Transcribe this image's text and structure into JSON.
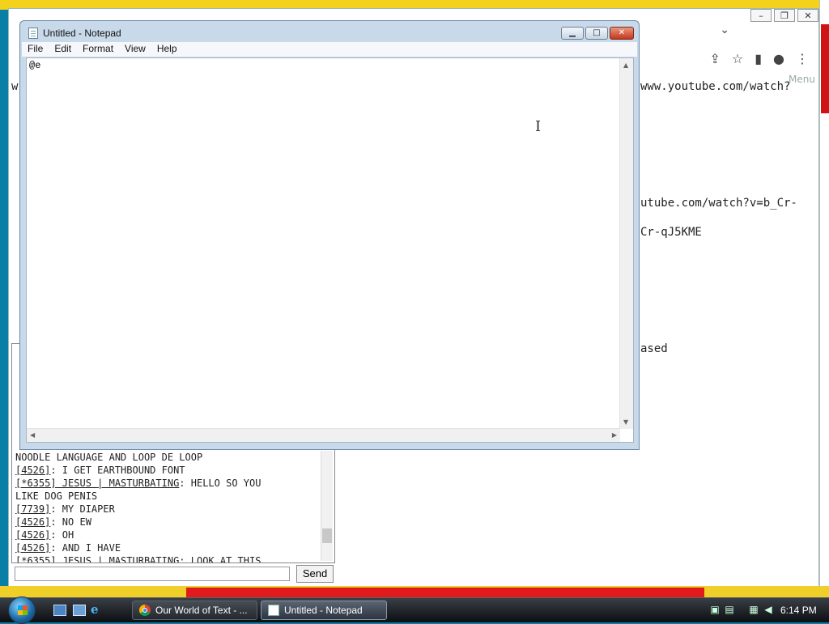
{
  "notepad": {
    "title": "Untitled - Notepad",
    "menu": [
      "File",
      "Edit",
      "Format",
      "View",
      "Help"
    ],
    "content": "@e"
  },
  "browser": {
    "menu_label": "Menu",
    "lines": [
      "www.youtube.com/watch?",
      "utube.com/watch?v=b_Cr-",
      "Cr-qJ5KME",
      "ased"
    ],
    "left_char": "w"
  },
  "chat": {
    "lines": [
      {
        "user": "",
        "text": "NOODLE LANGUAGE AND LOOP DE LOOP"
      },
      {
        "user": "[4526]",
        "text": ": I GET EARTHBOUND FONT"
      },
      {
        "user": "[*6355] JESUS | MASTURBATING",
        "text": ": HELLO SO YOU"
      },
      {
        "user": "",
        "text": "LIKE DOG PENIS"
      },
      {
        "user": "[7739]",
        "text": ": MY DIAPER"
      },
      {
        "user": "[4526]",
        "text": ": NO EW"
      },
      {
        "user": "[4526]",
        "text": ": OH"
      },
      {
        "user": "[4526]",
        "text": ": AND I HAVE"
      },
      {
        "user": "[*6355] JESUS | MASTURBATING",
        "text": ": LOOK AT THIS"
      }
    ],
    "send_label": "Send"
  },
  "taskbar": {
    "items": [
      {
        "label": "Our World of Text - ..."
      },
      {
        "label": "Untitled - Notepad"
      }
    ],
    "clock": "6:14 PM"
  }
}
